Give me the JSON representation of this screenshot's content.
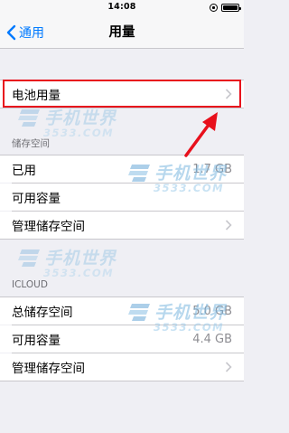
{
  "status_bar": {
    "time": "14:08"
  },
  "nav": {
    "back_label": "通用",
    "title": "用量"
  },
  "battery_row": {
    "label": "电池用量"
  },
  "storage": {
    "header": "储存空间",
    "rows": [
      {
        "label": "已用",
        "value": "1.7 GB"
      },
      {
        "label": "可用容量",
        "value": ""
      },
      {
        "label": "管理储存空间",
        "value": ""
      }
    ]
  },
  "icloud": {
    "header": "ICLOUD",
    "rows": [
      {
        "label": "总储存空间",
        "value": "5.0 GB"
      },
      {
        "label": "可用容量",
        "value": "4.4 GB"
      },
      {
        "label": "管理储存空间",
        "value": ""
      }
    ]
  },
  "watermark": {
    "brand_cn": "手机世界",
    "brand_domain": "3533.COM"
  },
  "colors": {
    "accent": "#007aff",
    "highlight": "#e8101c",
    "background": "#efeff4",
    "watermark": "#7bb7e0"
  }
}
